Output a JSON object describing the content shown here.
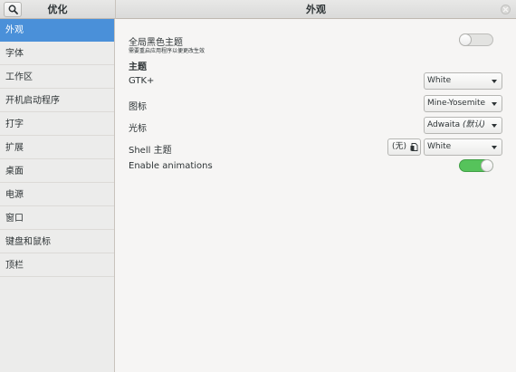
{
  "header": {
    "left_title": "优化",
    "main_title": "外观",
    "search_icon": "search-icon",
    "close_icon": "close-icon"
  },
  "sidebar": {
    "items": [
      {
        "label": "外观"
      },
      {
        "label": "字体"
      },
      {
        "label": "工作区"
      },
      {
        "label": "开机启动程序"
      },
      {
        "label": "打字"
      },
      {
        "label": "扩展"
      },
      {
        "label": "桌面"
      },
      {
        "label": "电源"
      },
      {
        "label": "窗口"
      },
      {
        "label": "键盘和鼠标"
      },
      {
        "label": "顶栏"
      }
    ]
  },
  "main": {
    "dark_theme": {
      "label": "全局黑色主题",
      "sublabel": "需要重启应用程序以便更改生效",
      "enabled": false
    },
    "theme_heading": "主题",
    "gtk": {
      "label": "GTK+",
      "value": "White"
    },
    "icons": {
      "label": "图标",
      "value": "Mine-Yosemite"
    },
    "cursor": {
      "label": "光标",
      "value_name": "Adwaita",
      "value_default": "(默认)"
    },
    "shell": {
      "label": "Shell 主题",
      "none_label": "(无)",
      "value": "White",
      "file_icon": "folder-icon"
    },
    "animations": {
      "label": "Enable animations",
      "enabled": true
    }
  },
  "colors": {
    "selection": "#4a90d9",
    "switch_on": "#56c35b"
  }
}
